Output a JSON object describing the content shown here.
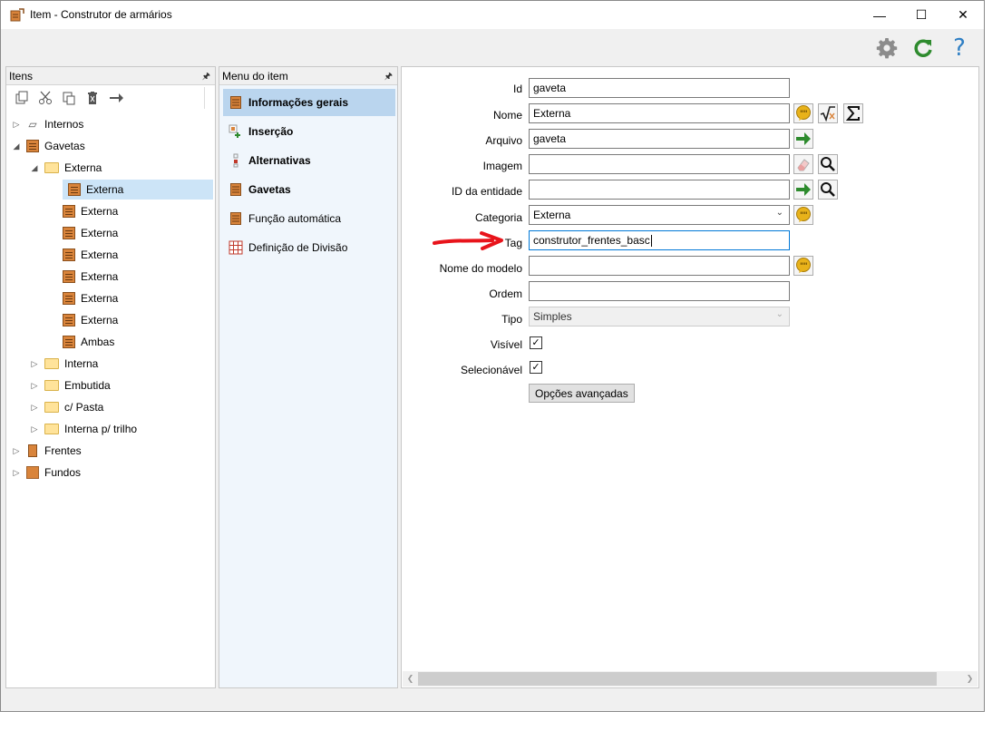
{
  "window": {
    "title": "Item - Construtor de armários",
    "controls": {
      "minimize": "—",
      "maximize": "☐",
      "close": "✕"
    }
  },
  "toolbar": {
    "icons": [
      "gear-icon",
      "refresh-icon",
      "help-icon"
    ],
    "help_glyph": "?"
  },
  "itens_panel": {
    "title": "Itens",
    "pin": "🖈",
    "tools": [
      "copy-icon",
      "cut-icon",
      "paste-icon",
      "delete-icon",
      "arrow-right-icon"
    ],
    "tree": [
      {
        "label": "Internos",
        "level": 0,
        "expanded": false,
        "icon": "internos"
      },
      {
        "label": "Gavetas",
        "level": 0,
        "expanded": true,
        "icon": "gaveta"
      },
      {
        "label": "Externa",
        "level": 1,
        "expanded": true,
        "icon": "folder"
      },
      {
        "label": "Externa",
        "level": 2,
        "icon": "gaveta",
        "selected": true
      },
      {
        "label": "Externa",
        "level": 2,
        "icon": "gaveta"
      },
      {
        "label": "Externa",
        "level": 2,
        "icon": "gaveta"
      },
      {
        "label": "Externa",
        "level": 2,
        "icon": "gaveta"
      },
      {
        "label": "Externa",
        "level": 2,
        "icon": "gaveta"
      },
      {
        "label": "Externa",
        "level": 2,
        "icon": "gaveta"
      },
      {
        "label": "Externa",
        "level": 2,
        "icon": "gaveta"
      },
      {
        "label": "Ambas",
        "level": 2,
        "icon": "gaveta"
      },
      {
        "label": "Interna",
        "level": 1,
        "expanded": false,
        "icon": "folder"
      },
      {
        "label": "Embutida",
        "level": 1,
        "expanded": false,
        "icon": "folder"
      },
      {
        "label": "c/ Pasta",
        "level": 1,
        "expanded": false,
        "icon": "folder"
      },
      {
        "label": "Interna p/ trilho",
        "level": 1,
        "expanded": false,
        "icon": "folder"
      },
      {
        "label": "Frentes",
        "level": 0,
        "expanded": false,
        "icon": "frente"
      },
      {
        "label": "Fundos",
        "level": 0,
        "expanded": false,
        "icon": "fundo"
      }
    ]
  },
  "menu_panel": {
    "title": "Menu do item",
    "pin": "🖈",
    "items": [
      {
        "label": "Informações gerais",
        "bold": true,
        "selected": true,
        "icon": "gaveta-icon"
      },
      {
        "label": "Inserção",
        "bold": true,
        "icon": "insert-icon"
      },
      {
        "label": "Alternativas",
        "bold": true,
        "icon": "alternatives-icon"
      },
      {
        "label": "Gavetas",
        "bold": true,
        "icon": "gaveta-icon"
      },
      {
        "label": "Função automática",
        "bold": false,
        "icon": "gaveta-icon"
      },
      {
        "label": "Definição de Divisão",
        "bold": false,
        "icon": "grid-icon"
      }
    ]
  },
  "form": {
    "id": {
      "label": "Id",
      "value": "gaveta"
    },
    "nome": {
      "label": "Nome",
      "value": "Externa"
    },
    "arquivo": {
      "label": "Arquivo",
      "value": "gaveta"
    },
    "imagem": {
      "label": "Imagem",
      "value": ""
    },
    "id_entidade": {
      "label": "ID da entidade",
      "value": ""
    },
    "categoria": {
      "label": "Categoria",
      "value": "Externa"
    },
    "tag": {
      "label": "Tag",
      "value": "construtor_frentes_basc"
    },
    "nome_modelo": {
      "label": "Nome do modelo",
      "value": ""
    },
    "ordem": {
      "label": "Ordem",
      "value": ""
    },
    "tipo": {
      "label": "Tipo",
      "value": "Simples"
    },
    "visivel": {
      "label": "Visível",
      "checked": true
    },
    "selecionavel": {
      "label": "Selecionável",
      "checked": true
    },
    "advanced_button": "Opções avançadas",
    "check_glyph": "✓",
    "caret": "⌄"
  },
  "colors": {
    "accent": "#0078d7",
    "arrow_annotation": "#e8141b",
    "green_arrow": "#2e8b2e",
    "selection": "#cce4f7"
  }
}
